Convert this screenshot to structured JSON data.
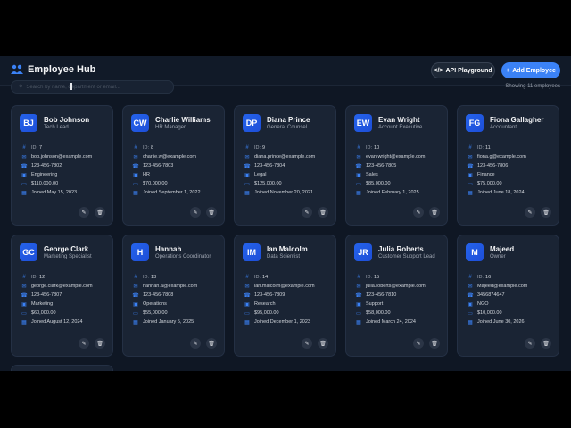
{
  "app": {
    "title": "Employee Hub",
    "api_button": "API Playground",
    "add_button": "Add Employee",
    "search_placeholder": "Search by name, department or email...",
    "showing": "Showing 11 employees"
  },
  "colors": {
    "accent": "#3b82f6",
    "background": "#0f1724",
    "card": "#1a2434"
  },
  "employees": [
    {
      "initials": "BJ",
      "name": "Bob Johnson",
      "role": "Tech Lead",
      "id_label": "ID:",
      "id": "7",
      "email": "bob.johnson@example.com",
      "phone": "123-456-7802",
      "dept": "Engineering",
      "salary": "$110,000.00",
      "joined": "Joined May 15, 2023"
    },
    {
      "initials": "CW",
      "name": "Charlie Williams",
      "role": "HR Manager",
      "id_label": "ID:",
      "id": "8",
      "email": "charlie.w@example.com",
      "phone": "123-456-7803",
      "dept": "HR",
      "salary": "$70,000.00",
      "joined": "Joined September 1, 2022"
    },
    {
      "initials": "DP",
      "name": "Diana Prince",
      "role": "General Counsel",
      "id_label": "ID:",
      "id": "9",
      "email": "diana.prince@example.com",
      "phone": "123-456-7804",
      "dept": "Legal",
      "salary": "$125,000.00",
      "joined": "Joined November 20, 2021"
    },
    {
      "initials": "EW",
      "name": "Evan Wright",
      "role": "Account Executive",
      "id_label": "ID:",
      "id": "10",
      "email": "evan.wright@example.com",
      "phone": "123-456-7805",
      "dept": "Sales",
      "salary": "$85,000.00",
      "joined": "Joined February 1, 2025"
    },
    {
      "initials": "FG",
      "name": "Fiona Gallagher",
      "role": "Accountant",
      "id_label": "ID:",
      "id": "11",
      "email": "fiona.g@example.com",
      "phone": "123-456-7806",
      "dept": "Finance",
      "salary": "$75,000.00",
      "joined": "Joined June 18, 2024"
    },
    {
      "initials": "GC",
      "name": "George Clark",
      "role": "Marketing Specialist",
      "id_label": "ID:",
      "id": "12",
      "email": "george.clark@example.com",
      "phone": "123-456-7807",
      "dept": "Marketing",
      "salary": "$60,000.00",
      "joined": "Joined August 12, 2024"
    },
    {
      "initials": "H",
      "name": "Hannah",
      "role": "Operations Coordinator",
      "id_label": "ID:",
      "id": "13",
      "email": "hannah.a@example.com",
      "phone": "123-456-7808",
      "dept": "Operations",
      "salary": "$55,000.00",
      "joined": "Joined January 5, 2025"
    },
    {
      "initials": "IM",
      "name": "Ian Malcolm",
      "role": "Data Scientist",
      "id_label": "ID:",
      "id": "14",
      "email": "ian.malcolm@example.com",
      "phone": "123-456-7809",
      "dept": "Research",
      "salary": "$95,000.00",
      "joined": "Joined December 1, 2023"
    },
    {
      "initials": "JR",
      "name": "Julia Roberts",
      "role": "Customer Support Lead",
      "id_label": "ID:",
      "id": "15",
      "email": "julia.roberts@example.com",
      "phone": "123-456-7810",
      "dept": "Support",
      "salary": "$58,000.00",
      "joined": "Joined March 24, 2024"
    },
    {
      "initials": "M",
      "name": "Majeed",
      "role": "Owner",
      "id_label": "ID:",
      "id": "16",
      "email": "Majeed@example.com",
      "phone": "3456874647",
      "dept": "NGO",
      "salary": "$10,000.00",
      "joined": "Joined June 30, 2026"
    }
  ]
}
